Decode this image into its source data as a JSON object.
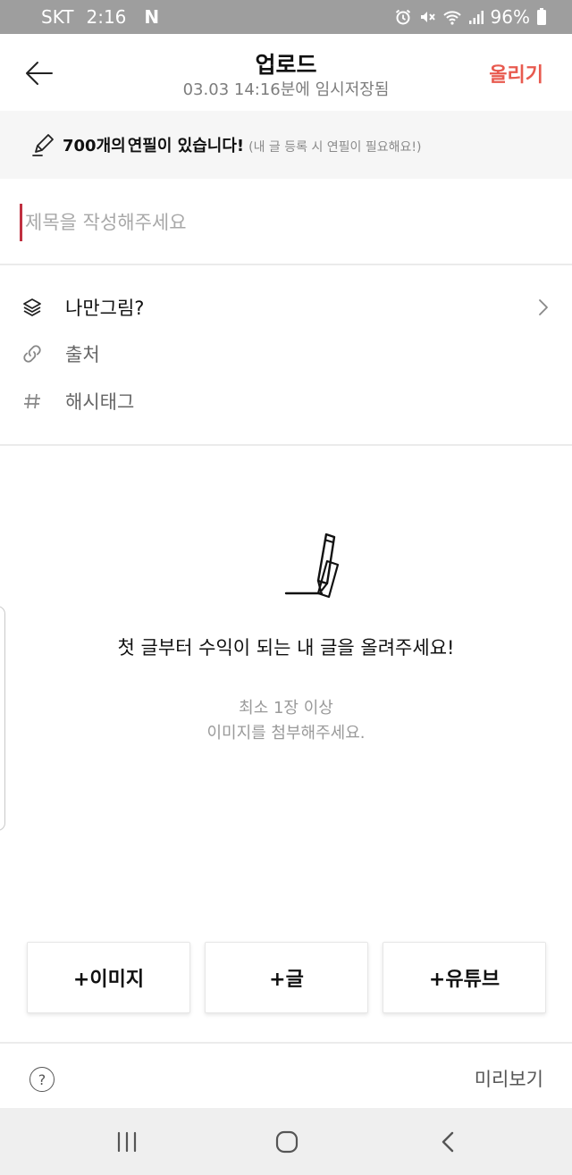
{
  "status_bar": {
    "carrier": "SKT",
    "time": "2:16",
    "app_notification": "N",
    "battery": "96%",
    "icons": [
      "alarm-icon",
      "mute-icon",
      "wifi-icon",
      "signal-icon",
      "battery-icon"
    ]
  },
  "header": {
    "back_icon": "arrow-left-icon",
    "title": "업로드",
    "subtitle": "03.03 14:16분에 임시저장됨",
    "upload_label": "올리기",
    "accent_color": "#e85a4f"
  },
  "pencil_banner": {
    "icon": "pencil-icon",
    "count_text": "700개의",
    "strong_text": "연필이 있습니다!",
    "note": "(내 글 등록 시 연필이 필요해요!)"
  },
  "title_input": {
    "placeholder": "제목을 작성해주세요",
    "value": ""
  },
  "options": [
    {
      "icon": "layers-icon",
      "label": "나만그림?",
      "has_chevron": true
    },
    {
      "icon": "link-icon",
      "label": "출처"
    },
    {
      "icon": "hash-icon",
      "label": "해시태그"
    }
  ],
  "empty_state": {
    "illustration": "pencil-writing-icon",
    "title": "첫 글부터 수익이 되는 내 글을 올려주세요!",
    "subtitle_line1": "최소 1장 이상",
    "subtitle_line2": "이미지를 첨부해주세요."
  },
  "add_buttons": [
    {
      "label": "+이미지"
    },
    {
      "label": "+글"
    },
    {
      "label": "+유튜브"
    }
  ],
  "bottom_bar": {
    "help_label": "?",
    "preview_label": "미리보기"
  },
  "nav_bar": {
    "icons": [
      "recent-apps-icon",
      "home-icon",
      "back-icon"
    ]
  }
}
